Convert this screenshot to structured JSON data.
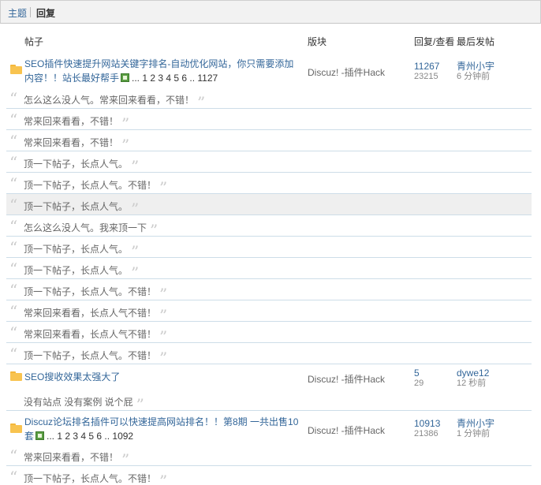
{
  "tabs": {
    "topics": "主题",
    "replies": "回复"
  },
  "headers": {
    "post": "帖子",
    "forum": "版块",
    "counts": "回复/查看",
    "last": "最后发帖"
  },
  "quote_open": "“",
  "quote_close": "”",
  "threads": [
    {
      "title": "SEO插件快速提升网站关键字排名-自动优化网站，你只需要添加内容！！站长最好帮手",
      "pages": "... 1 2 3 4 5 6 .. 1127",
      "forum": "Discuz! -插件Hack",
      "replies": "11267",
      "views": "23215",
      "author": "青州小宇",
      "time": "6 分钟前",
      "reply_items": [
        "怎么这么没人气。常来回来看看，不错！",
        "常来回来看看，不错！",
        "常来回来看看，不错！",
        "顶一下帖子，长点人气。",
        "顶一下帖子，长点人气。不错！",
        "顶一下帖子，长点人气。",
        "怎么这么没人气。我来顶一下",
        "顶一下帖子，长点人气。",
        "顶一下帖子，长点人气。",
        "顶一下帖子，长点人气。不错！",
        "常来回来看看，长点人气不错！",
        "常来回来看看，长点人气不错！",
        "顶一下帖子，长点人气。不错！"
      ]
    },
    {
      "title": "SEO搜收效果太强大了",
      "forum": "Discuz! -插件Hack",
      "replies": "5",
      "views": "29",
      "author": "dywe12",
      "time": "12 秒前",
      "reply_items": [
        "没有站点 没有案例 说个屁"
      ]
    },
    {
      "title": "Discuz论坛排名插件可以快速提高网站排名！！第8期 一共出售10套",
      "pages": "... 1 2 3 4 5 6 .. 1092",
      "forum": "Discuz! -插件Hack",
      "replies": "10913",
      "views": "21386",
      "author": "青州小宇",
      "time": "1 分钟前",
      "reply_items": [
        "常来回来看看，不错！",
        "顶一下帖子，长点人气。不错！"
      ]
    }
  ],
  "colors": {
    "link": "#336699",
    "row_border": "#cddde8",
    "highlight": "#efefef",
    "folder": "#f8c34f"
  }
}
